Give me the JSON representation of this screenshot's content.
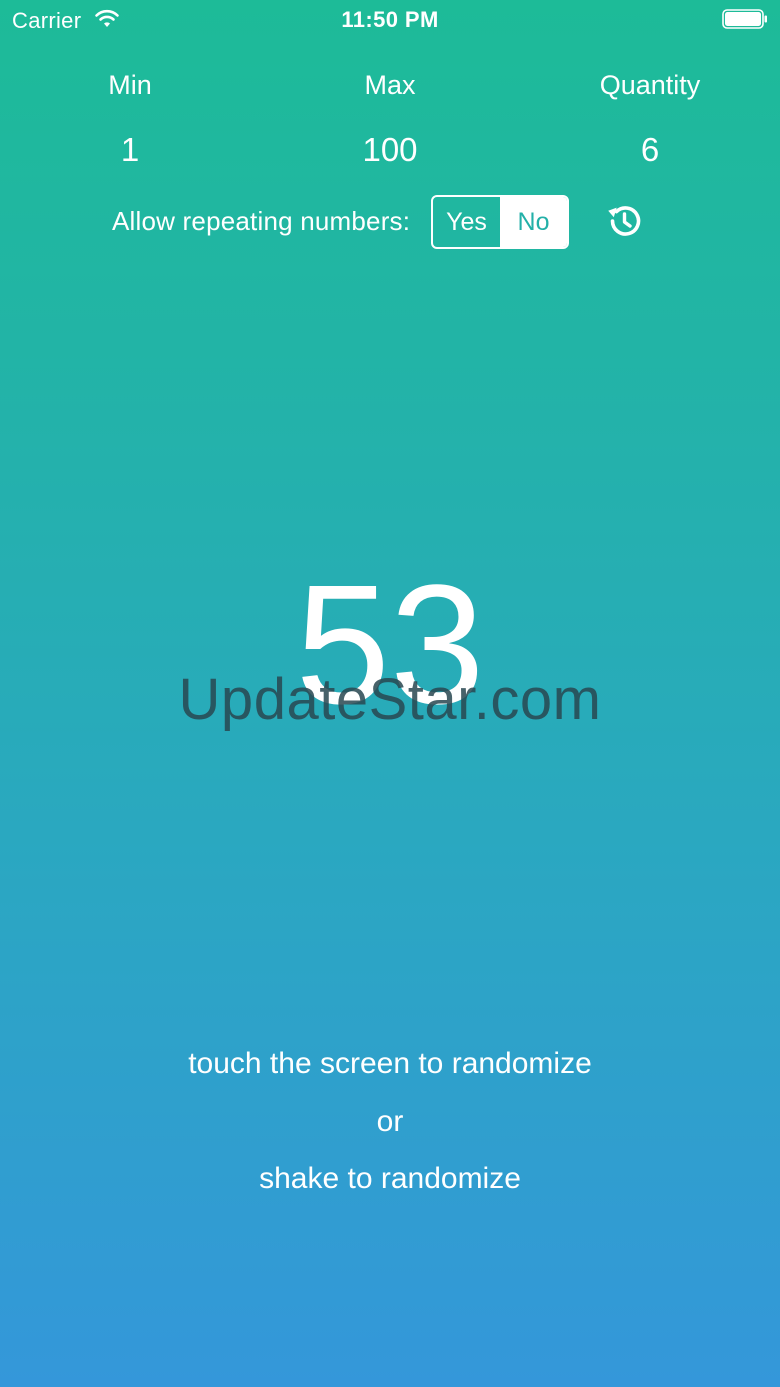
{
  "status_bar": {
    "carrier": "Carrier",
    "time": "11:50 PM",
    "icons": [
      "wifi-icon",
      "battery-icon"
    ]
  },
  "settings": {
    "min_label": "Min",
    "min_value": "1",
    "max_label": "Max",
    "max_value": "100",
    "quantity_label": "Quantity",
    "quantity_value": "6",
    "repeat_label": "Allow repeating numbers:",
    "repeat_options": [
      "Yes",
      "No"
    ],
    "repeat_selected": "No",
    "history_icon": "history-icon"
  },
  "result": {
    "number": "53"
  },
  "watermark": "UpdateStar.com",
  "instructions": {
    "line1": "touch the screen to randomize",
    "line2": "or",
    "line3": "shake to randomize"
  },
  "colors": {
    "gradient_top": "#1dbb98",
    "gradient_bottom": "#3497da",
    "accent_text": "#23b0a8"
  }
}
